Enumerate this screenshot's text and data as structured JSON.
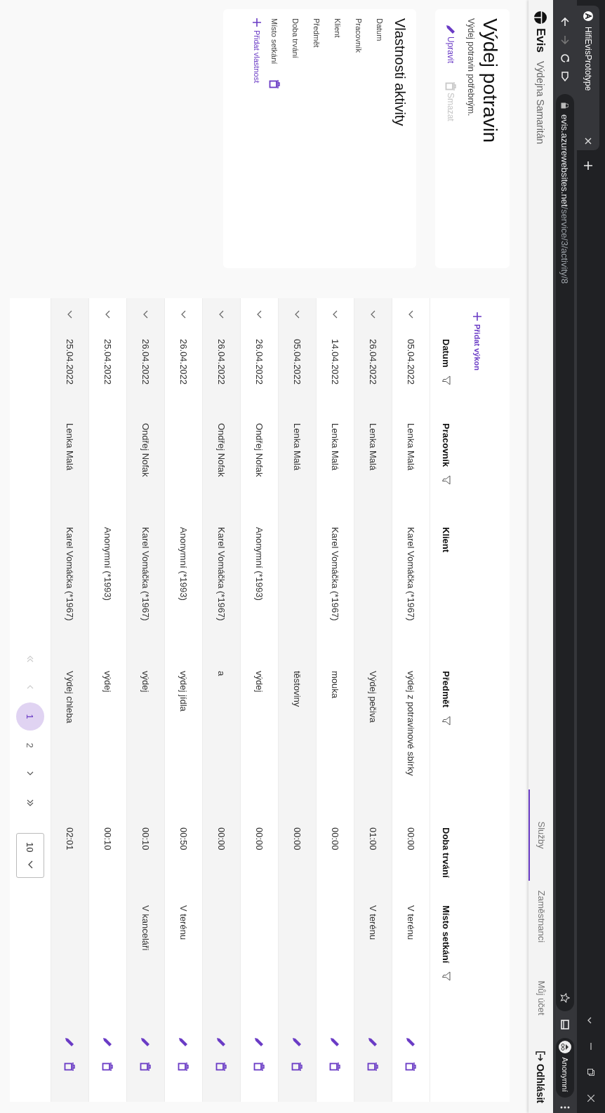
{
  "browser": {
    "tab_title": "HifiEvisPrototype",
    "url_host": "evis.azurewebsites.net",
    "url_path": "/service/3/activity/8",
    "profile": "Anonymní"
  },
  "app_header": {
    "brand": "Evis",
    "subtitle": "Výdejna Samaritán",
    "nav": [
      {
        "label": "Služby",
        "selected": true
      },
      {
        "label": "Zaměstnanci",
        "selected": false
      },
      {
        "label": "Můj účet",
        "selected": false
      }
    ],
    "logout": "Odhlásit"
  },
  "activity": {
    "title": "Výdej potravin",
    "description": "Výdej potravin potřebným.",
    "actions": [
      {
        "kind": "edit",
        "label": "Upravit",
        "disabled": false
      },
      {
        "kind": "delete",
        "label": "Smazat",
        "disabled": true
      }
    ]
  },
  "properties": {
    "title": "Vlastnosti aktivity",
    "items": [
      {
        "label": "Datum",
        "deletable": false
      },
      {
        "label": "Pracovník",
        "deletable": false
      },
      {
        "label": "Klient",
        "deletable": false
      },
      {
        "label": "Předmět",
        "deletable": false
      },
      {
        "label": "Doba trvání",
        "deletable": false
      },
      {
        "label": "Místo setkání",
        "deletable": true
      }
    ],
    "add_label": "Přidat vlastnost"
  },
  "table": {
    "add_label": "Přidat výkon",
    "columns": [
      {
        "label": "Datum",
        "filterable": true
      },
      {
        "label": "Pracovník",
        "filterable": true
      },
      {
        "label": "Klient",
        "filterable": false
      },
      {
        "label": "Předmět",
        "filterable": true
      },
      {
        "label": "Doba trvání",
        "filterable": false
      },
      {
        "label": "Místo setkání",
        "filterable": true
      }
    ],
    "rows": [
      {
        "date": "05.04.2022",
        "worker": "Lenka Malá",
        "client": "Karel Vomáčka (*1967)",
        "subject": "výdej z potravinové sbírky",
        "duration": "00:00",
        "place": "V terénu"
      },
      {
        "date": "26.04.2022",
        "worker": "Lenka Malá",
        "subject": "Výdej pečiva",
        "duration": "01:00",
        "place": "V terénu"
      },
      {
        "date": "14.04.2022",
        "worker": "Lenka Malá",
        "client": "Karel Vomáčka (*1967)",
        "subject": "mouka",
        "duration": "00:00"
      },
      {
        "date": "05.04.2022",
        "worker": "Lenka Malá",
        "subject": "těstoviny",
        "duration": "00:00"
      },
      {
        "date": "26.04.2022",
        "worker": "Ondřej Nofak",
        "client": "Anonymní (*1993)",
        "subject": "výdej",
        "duration": "00:00"
      },
      {
        "date": "26.04.2022",
        "worker": "Ondřej Nofak",
        "client": "Karel Vomáčka (*1967)",
        "subject": "a",
        "duration": "00:00"
      },
      {
        "date": "26.04.2022",
        "client": "Anonymní (*1993)",
        "subject": "výdej jídla",
        "duration": "00:50",
        "place": "V terénu"
      },
      {
        "date": "26.04.2022",
        "worker": "Ondřej Nofak",
        "client": "Karel Vomáčka (*1967)",
        "subject": "výdej",
        "duration": "00:10",
        "place": "V kanceláři"
      },
      {
        "date": "25.04.2022",
        "client": "Anonymní (*1993)",
        "subject": "výdej",
        "duration": "00:10"
      },
      {
        "date": "25.04.2022",
        "worker": "Lenka Malá",
        "client": "Karel Vomáčka (*1967)",
        "subject": "Výdej chleba",
        "duration": "02:01"
      }
    ],
    "pagination": {
      "nav": [
        {
          "kind": "first",
          "disabled": true
        },
        {
          "kind": "prev",
          "disabled": true
        },
        {
          "kind": "next",
          "disabled": false
        },
        {
          "kind": "last",
          "disabled": false
        }
      ],
      "pages": [
        {
          "label": "1",
          "selected": true
        },
        {
          "label": "2",
          "selected": false
        }
      ],
      "page_size": "10"
    }
  }
}
